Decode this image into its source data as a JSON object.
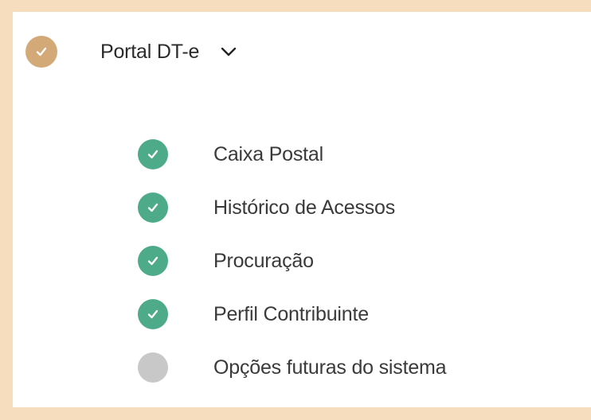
{
  "colors": {
    "background_frame": "#f6ddbd",
    "panel": "#ffffff",
    "header_status": "#d4a978",
    "done_status": "#4eab8a",
    "pending_status": "#c8c8c8",
    "text": "#2b2b2b"
  },
  "menu": {
    "title": "Portal DT-e",
    "expanded": true,
    "status_icon": "check-icon",
    "toggle_icon": "chevron-down-icon",
    "items": [
      {
        "label": "Caixa Postal",
        "status": "done",
        "icon": "check-icon"
      },
      {
        "label": "Histórico de Acessos",
        "status": "done",
        "icon": "check-icon"
      },
      {
        "label": "Procuração",
        "status": "done",
        "icon": "check-icon"
      },
      {
        "label": "Perfil Contribuinte",
        "status": "done",
        "icon": "check-icon"
      },
      {
        "label": "Opções futuras do sistema",
        "status": "pending",
        "icon": "empty-circle-icon"
      }
    ]
  }
}
